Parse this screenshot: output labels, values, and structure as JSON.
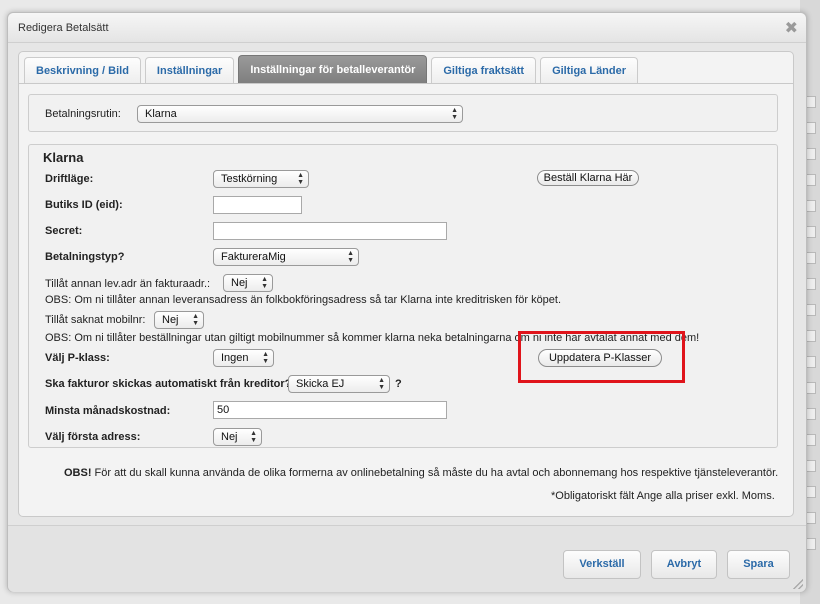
{
  "dialog": {
    "title": "Redigera Betalsätt",
    "close_symbol": "✖"
  },
  "tabs": [
    {
      "label": "Beskrivning / Bild",
      "active": false
    },
    {
      "label": "Inställningar",
      "active": false
    },
    {
      "label": "Inställningar för betalleverantör",
      "active": true
    },
    {
      "label": "Giltiga fraktsätt",
      "active": false
    },
    {
      "label": "Giltiga Länder",
      "active": false
    }
  ],
  "payment_routine": {
    "label": "Betalningsrutin:",
    "value": "Klarna"
  },
  "klarna": {
    "heading": "Klarna",
    "mode": {
      "label": "Driftläge:",
      "value": "Testkörning"
    },
    "order_button": "Beställ Klarna Här",
    "shop_id": {
      "label": "Butiks ID (eid):",
      "value": ""
    },
    "secret": {
      "label": "Secret:",
      "value": ""
    },
    "payment_type": {
      "label": "Betalningstyp?",
      "value": "FaktureraMig"
    },
    "allow_other_address": {
      "label": "Tillåt annan lev.adr än fakturaadr.:",
      "value": "Nej"
    },
    "note_address": "OBS: Om ni tillåter annan leveransadress än folkbokföringsadress så tar Klarna inte kreditrisken för köpet.",
    "allow_missing_mobile": {
      "label": "Tillåt saknat mobilnr:",
      "value": "Nej"
    },
    "note_mobile": "OBS: Om ni tillåter beställningar utan giltigt mobilnummer så kommer klarna neka betalningarna om ni inte har avtalat annat med dem!",
    "p_class": {
      "label": "Välj P-klass:",
      "value": "Ingen"
    },
    "update_p_class_button": "Uppdatera P-Klasser",
    "auto_send_invoices": {
      "label": "Ska fakturor skickas automatiskt från kreditor?",
      "value": "Skicka EJ",
      "suffix": "?"
    },
    "min_monthly_cost": {
      "label": "Minsta månadskostnad:",
      "value": "50"
    },
    "first_address": {
      "label": "Välj första adress:",
      "value": "Nej"
    }
  },
  "notice": {
    "bold": "OBS!",
    "text": " För att du skall kunna använda de olika formerna av onlinebetalning så måste du ha avtal och abonnemang hos respektive tjänsteleverantör."
  },
  "required_note": "*Obligatoriskt fält Ange alla priser exkl. Moms.",
  "buttons": {
    "apply": "Verkställ",
    "cancel": "Avbryt",
    "save": "Spara"
  },
  "colors": {
    "highlight": "#e0141b",
    "link_blue": "#2b6aa8",
    "active_tab": "#8a8a8a"
  }
}
